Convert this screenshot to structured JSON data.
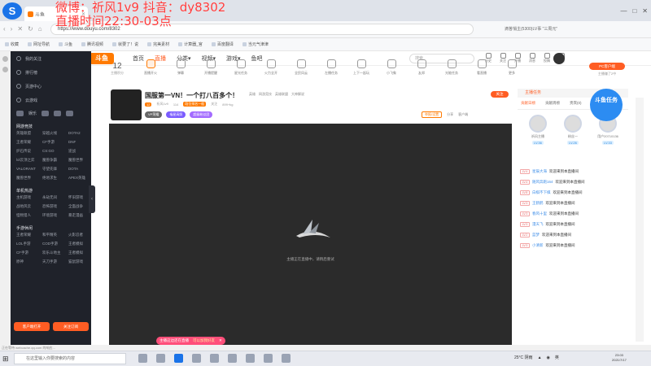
{
  "overlay": {
    "line1": "微博：祈风1v9      抖音：dy8302",
    "line2": "直播时间22:30-03点"
  },
  "browser": {
    "tab_label": "斗鱼",
    "url": "https://www.douyu.com/8302",
    "addr_right": "滴答悄主(5300)LV事 \"三周元\"",
    "back_label": "‹",
    "fwd_label": "›",
    "close_label": "✕",
    "reload_label": "↻",
    "home_label": "⌂"
  },
  "bookmarks": [
    "收藏",
    "网址导航",
    "斗鱼",
    "腾讯视频",
    "就要了！说",
    "完美素材",
    "计算器_官",
    "百度翻译",
    "当元气津津"
  ],
  "site": {
    "logo": "斗鱼",
    "nav": [
      "首页",
      "直播",
      "分类▾",
      "视频▾",
      "游戏▾",
      "鱼吧"
    ],
    "active_nav": "直播",
    "search_placeholder": "搜索",
    "header_icons": [
      "历史",
      "关注",
      "开播",
      "消息",
      "投稿",
      "注册"
    ]
  },
  "leftmenu": {
    "items": [
      "我的关注",
      "排行榜",
      "页游中心",
      "云游戏"
    ],
    "icon_row_label": "娱乐",
    "section1": "网游竞技",
    "grid1": [
      "英雄联盟",
      "穿越火线",
      "DOTA2",
      "王者荣耀",
      "CF手游",
      "DNF",
      "炉石传说",
      "CS:GO",
      "逆战",
      "lol云顶之弈",
      "魔兽争霸",
      "魔兽世界",
      "VALORANT",
      "守望先锋",
      "DOTA",
      "魔兽世界",
      "绝地求生",
      "APEX英雄"
    ],
    "section2": "单机热游",
    "grid2": [
      "主机游戏",
      "永劫无间",
      "怀旧游戏",
      "战地风云",
      "恐怖游戏",
      "全面战争",
      "怪物猎人",
      "环境游戏",
      "暴走漫画"
    ],
    "section3": "手游休闲",
    "grid3": [
      "王者荣耀",
      "和平精英",
      "火影忍者",
      "LOL手游",
      "COD手游",
      "王者模拟",
      "CF手游",
      "欢乐斗地主",
      "王者模拟",
      "原神",
      "天刀手游",
      "猫鼠游戏"
    ],
    "btn_client": "客户端打开",
    "btn_subscribe": "关注订阅"
  },
  "categories": {
    "level_num": "12",
    "level_label": "主播积分",
    "items": [
      "直播开火",
      "弹幕",
      "开播提醒",
      "星光任务",
      "火力全开",
      "全民风云",
      "左播任务",
      "上下一起玩",
      "小飞象",
      "友邦",
      "光能任务",
      "看直播",
      "更多"
    ],
    "pc_badge": "PC客户端",
    "pc_sub": "主播赚了2中"
  },
  "room": {
    "title": "国服第一VN！一个打八百多个！",
    "tags": [
      "英雄",
      "网游竞技",
      "英雄联盟",
      "大神解说"
    ],
    "level": "12",
    "name": "祈风1v9",
    "hot": "114",
    "rank": "段位排名一般",
    "meta_right": "关注",
    "fans": "899+kg",
    "badges": [
      "VP荣耀",
      "福星高照",
      "超级粉丝团"
    ],
    "follow_label": "关注",
    "report_label": "举报/设置",
    "share_label": "分享",
    "dl_label": "客户端"
  },
  "player": {
    "message": "主播正在直播中，请稍后重试"
  },
  "pill": {
    "text1": "主播这边还在直播",
    "text2": "可以加我好友",
    "close": "✕"
  },
  "rpanel": {
    "head": "主播任务",
    "tabs": [
      "贡献日榜",
      "贡献周榜",
      "贵宾(0)",
      "粉丝"
    ],
    "cards": [
      {
        "name": "祈风主播",
        "lv": "LV.36"
      },
      {
        "name": "粉丝一",
        "lv": "LV.26"
      },
      {
        "name": "用户20710136",
        "lv": "LV.33"
      }
    ],
    "chat": [
      {
        "lv": "LV.4",
        "user": "星辰大海",
        "msg": "欢迎来到本直播间"
      },
      {
        "lv": "LV.4",
        "user": "随风奔跑164",
        "msg": "欢迎来到本直播间"
      },
      {
        "lv": "LV.8",
        "user": "白棋不下棋",
        "msg": "欢迎来到本直播间"
      },
      {
        "lv": "LV.3",
        "user": "王鹤鹤",
        "msg": "欢迎来到本直播间"
      },
      {
        "lv": "LV.3",
        "user": "春风十里",
        "msg": "欢迎来到本直播间"
      },
      {
        "lv": "LV.3",
        "user": "漫天飞",
        "msg": "欢迎来到本直播间"
      },
      {
        "lv": "LV.2",
        "user": "蓝梦",
        "msg": "欢迎来到本直播间"
      },
      {
        "lv": "LV.3",
        "user": "小清新",
        "msg": "欢迎来到本直播间"
      }
    ]
  },
  "task_badge": "斗鱼任务",
  "statusline": "正在等待 webcache.qq.com 的响应...",
  "taskbar": {
    "search_placeholder": "在这里输入你要搜索的内容",
    "weather": "25°C 阴雨",
    "time": "23:03",
    "date": "2021/7/17",
    "lang": "英"
  },
  "colors": {
    "accent": "#ff5d23",
    "overlay_text": "#ff3b3b",
    "menu_bg": "#1f222a",
    "player_bg": "#2b2b2b"
  }
}
